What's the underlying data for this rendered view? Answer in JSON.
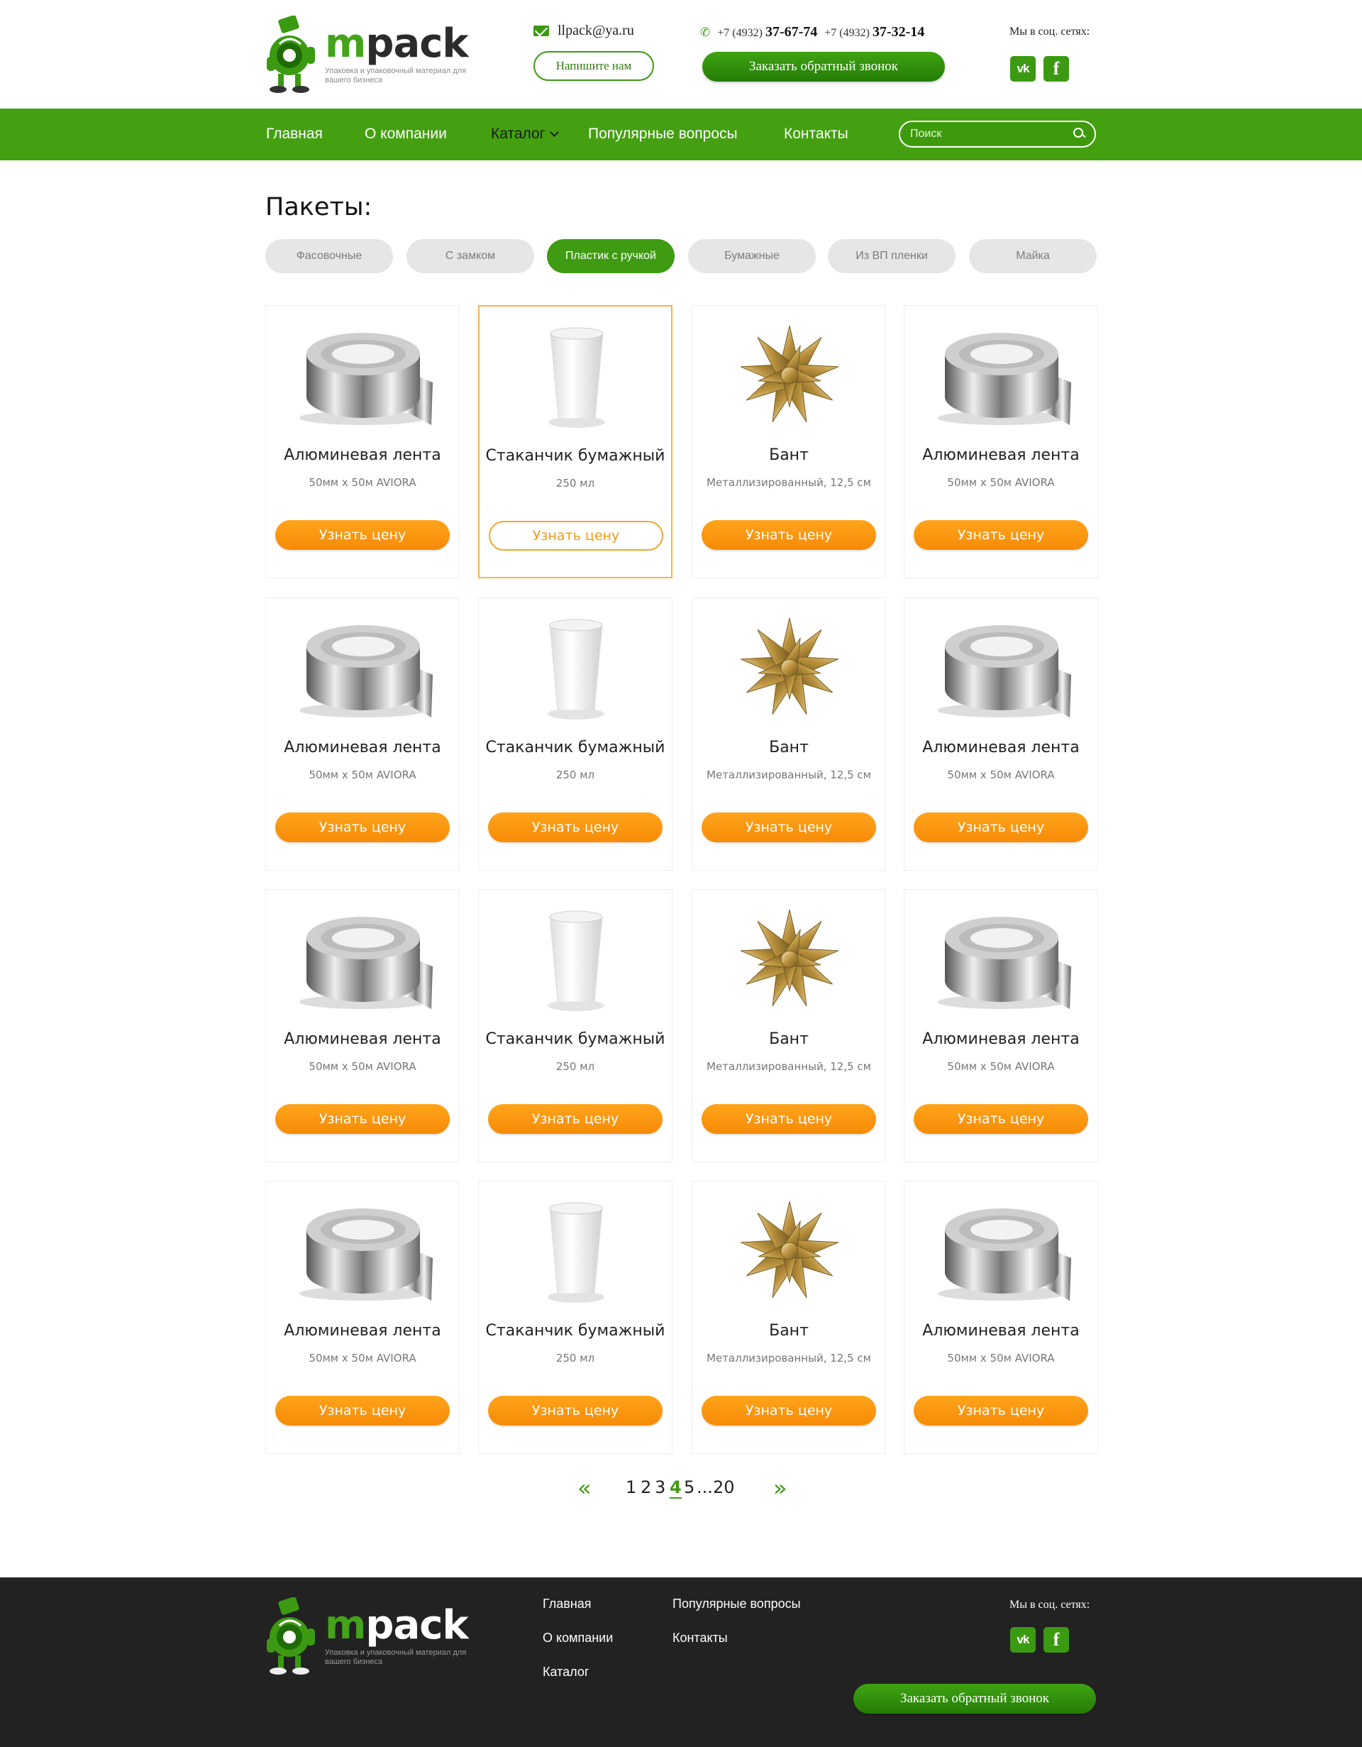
{
  "brand": {
    "name_m": "m",
    "name_rest": "pack",
    "tagline": "Упаковка и упаковочный материал для вашего бизнеса"
  },
  "header": {
    "email": "llpack@ya.ru",
    "write_button": "Напишите нам",
    "phone1_prefix": "+7 (4932)",
    "phone1_number": "37-67-74",
    "phone2_prefix": "+7 (4932)",
    "phone2_number": "37-32-14",
    "callback_button": "Заказать обратный звонок",
    "social_label": "Мы в соц. сетях:",
    "vk_label": "vk",
    "fb_label": "f"
  },
  "nav": {
    "items": [
      "Главная",
      "О компании",
      "Каталог",
      "Популярные вопросы",
      "Контакты"
    ],
    "active": "Каталог",
    "search_placeholder": "Поиск"
  },
  "catalog": {
    "title": "Пакеты:",
    "filters": [
      "Фасовочные",
      "С замком",
      "Пластик с ручкой",
      "Бумажные",
      "Из ВП пленки",
      "Майка"
    ],
    "active_filter": "Пластик с ручкой",
    "cards": [
      {
        "title": "Алюминевая лента",
        "sub": "50мм х 50м AVIORA",
        "button": "Узнать цену",
        "image": "tape"
      },
      {
        "title": "Стаканчик бумажный",
        "sub": "250 мл",
        "button": "Узнать цену",
        "image": "cup"
      },
      {
        "title": "Бант",
        "sub": "Металлизированный, 12,5 см",
        "button": "Узнать цену",
        "image": "bow"
      },
      {
        "title": "Алюминевая лента",
        "sub": "50мм х 50м AVIORA",
        "button": "Узнать цену",
        "image": "tape"
      }
    ]
  },
  "pagination": {
    "pages": [
      "1",
      "2",
      "3",
      "4",
      "5",
      "...",
      "20"
    ],
    "current": "4",
    "prev": "«",
    "next": "»"
  },
  "footer": {
    "links": [
      "Главная",
      "О компании",
      "Каталог",
      "Популярные вопросы",
      "Контакты"
    ],
    "social_label": "Мы в соц. сетях:",
    "callback_button": "Заказать обратный звонок"
  },
  "colors": {
    "green": "#44a010",
    "orange": "#f68b07",
    "footer_bg": "#222222"
  }
}
